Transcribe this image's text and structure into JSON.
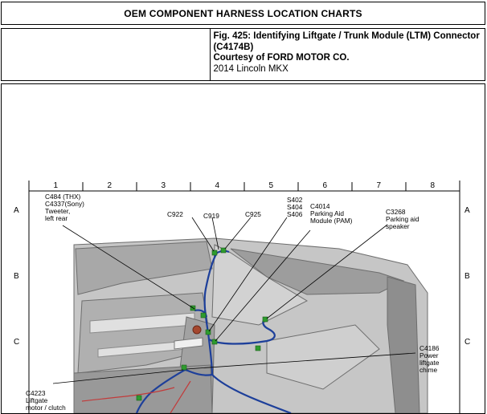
{
  "header": {
    "title": "OEM COMPONENT HARNESS LOCATION CHARTS"
  },
  "caption": {
    "figure": "Fig. 425: Identifying Liftgate / Trunk Module (LTM) Connector (C4174B)",
    "courtesy": "Courtesy of FORD MOTOR CO.",
    "vehicle": "2014 Lincoln MKX"
  },
  "diagram": {
    "col_labels": [
      "1",
      "2",
      "3",
      "4",
      "5",
      "6",
      "7",
      "8"
    ],
    "row_labels": [
      "A",
      "B",
      "C"
    ],
    "callouts": {
      "c484": [
        "C484 (THX)",
        "C4337(Sony)",
        "Tweeter,",
        "left rear"
      ],
      "c922": "C922",
      "c919": "C919",
      "c925": "C925",
      "s402": [
        "S402",
        "S404",
        "S406"
      ],
      "c4014": [
        "C4014",
        "Parking Aid",
        "Module (PAM)"
      ],
      "c3268": [
        "C3268",
        "Parking aid",
        "speaker"
      ],
      "c4186": [
        "C4186",
        "Power",
        "liftgate",
        "chime"
      ],
      "c4223": [
        "C4223",
        "Liftgate",
        "motor / clutch"
      ]
    },
    "colors": {
      "harness": "#1d3f9a",
      "connector": "#2e9b2e",
      "body": "#b9b9b9",
      "leader": "#000000"
    }
  }
}
